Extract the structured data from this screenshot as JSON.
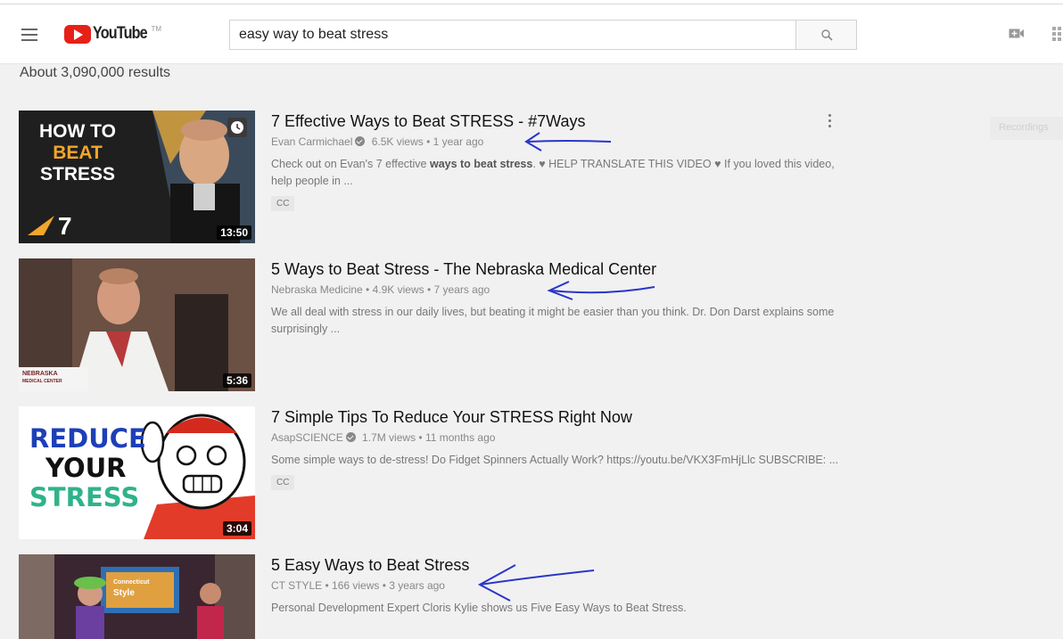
{
  "header": {
    "logo_text": "YouTube",
    "logo_tm": "TM",
    "search_value": "easy way to beat stress",
    "icons": [
      "menu-icon",
      "search-icon",
      "upload-video-icon",
      "apps-grid-icon"
    ]
  },
  "results_count": "About 3,090,000 results",
  "side_button_label": "Recordings",
  "results": [
    {
      "title": "7 Effective Ways to Beat STRESS - #7Ways",
      "channel": "Evan Carmichael",
      "verified": true,
      "views": "6.5K views",
      "age": "1 year ago",
      "desc_pre": "Check out on Evan's 7 effective ",
      "desc_bold": "ways to beat stress",
      "desc_post": ". ♥ HELP TRANSLATE THIS VIDEO ♥ If you loved this video, help people in ...",
      "badge": "CC",
      "duration": "13:50",
      "thumb_text": [
        "HOW TO",
        "BEAT",
        "STRESS",
        "7"
      ]
    },
    {
      "title": "5 Ways to Beat Stress - The Nebraska Medical Center",
      "channel": "Nebraska Medicine",
      "verified": false,
      "views": "4.9K views",
      "age": "7 years ago",
      "desc_pre": "We all deal with stress in our daily lives, but beating it might be easier than you think. Dr. Don Darst explains some surprisingly ...",
      "badge": "",
      "duration": "5:36",
      "thumb_text": [
        "NEBRASKA",
        "MEDICAL CENTER"
      ]
    },
    {
      "title": "7 Simple Tips To Reduce Your STRESS Right Now",
      "channel": "AsapSCIENCE",
      "verified": true,
      "views": "1.7M views",
      "age": "11 months ago",
      "desc_pre": "Some simple ways to de-stress! Do Fidget Spinners Actually Work? https://youtu.be/VKX3FmHjLlc SUBSCRIBE: ...",
      "badge": "CC",
      "duration": "3:04",
      "thumb_text": [
        "REDUCE",
        "YOUR",
        "STRESS"
      ]
    },
    {
      "title": "5 Easy Ways to Beat Stress",
      "channel": "CT STYLE",
      "verified": false,
      "views": "166 views",
      "age": "3 years ago",
      "desc_pre": "Personal Development Expert Cloris Kylie shows us Five Easy Ways to Beat Stress.",
      "badge": "",
      "duration": "",
      "thumb_text": [
        "Connecticut",
        "Style"
      ]
    }
  ],
  "colors": {
    "brand_red": "#e62117",
    "annotation_blue": "#2a36c9"
  }
}
